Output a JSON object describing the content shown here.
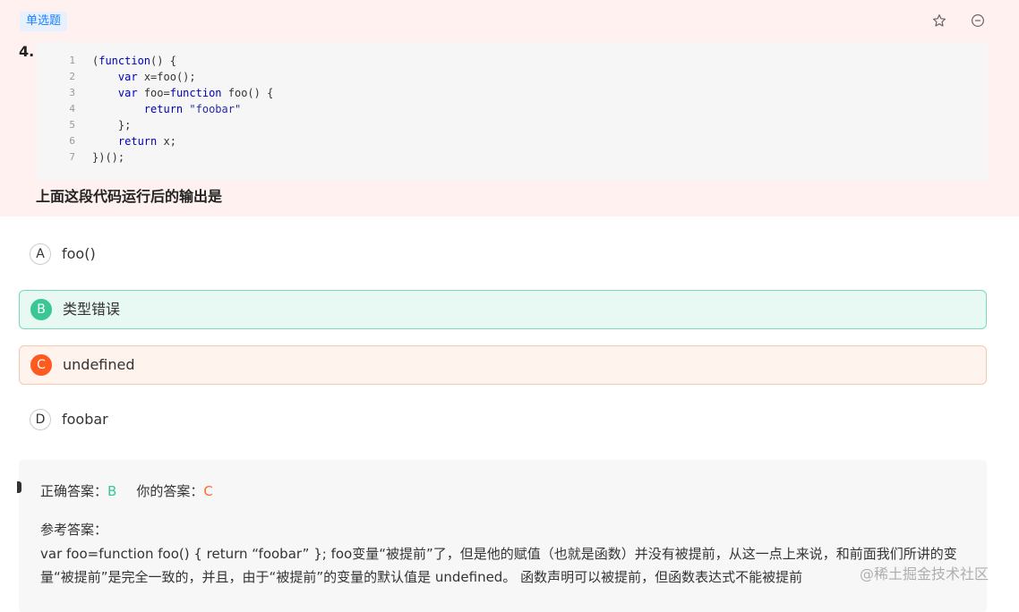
{
  "question": {
    "type_tag": "单选题",
    "number": "4.",
    "code_lines": [
      {
        "n": "1",
        "parts": [
          {
            "t": "(",
            "c": ""
          },
          {
            "t": "function",
            "c": "kw"
          },
          {
            "t": "() {",
            "c": ""
          }
        ]
      },
      {
        "n": "2",
        "parts": [
          {
            "t": "    ",
            "c": ""
          },
          {
            "t": "var",
            "c": "kw"
          },
          {
            "t": " x=foo();",
            "c": ""
          }
        ]
      },
      {
        "n": "3",
        "parts": [
          {
            "t": "    ",
            "c": ""
          },
          {
            "t": "var",
            "c": "kw"
          },
          {
            "t": " foo=",
            "c": ""
          },
          {
            "t": "function",
            "c": "kw"
          },
          {
            "t": " foo() {",
            "c": ""
          }
        ]
      },
      {
        "n": "4",
        "parts": [
          {
            "t": "        ",
            "c": ""
          },
          {
            "t": "return",
            "c": "kw"
          },
          {
            "t": " ",
            "c": ""
          },
          {
            "t": "\"foobar\"",
            "c": "str"
          }
        ]
      },
      {
        "n": "5",
        "parts": [
          {
            "t": "    };",
            "c": ""
          }
        ]
      },
      {
        "n": "6",
        "parts": [
          {
            "t": "    ",
            "c": ""
          },
          {
            "t": "return",
            "c": "kw"
          },
          {
            "t": " x;",
            "c": ""
          }
        ]
      },
      {
        "n": "7",
        "parts": [
          {
            "t": "})();",
            "c": ""
          }
        ]
      }
    ],
    "prompt": "上面这段代码运行后的输出是"
  },
  "options": [
    {
      "letter": "A",
      "text": "foo()",
      "state": "normal"
    },
    {
      "letter": "B",
      "text": "类型错误",
      "state": "correct"
    },
    {
      "letter": "C",
      "text": "undefined",
      "state": "wrong"
    },
    {
      "letter": "D",
      "text": "foobar",
      "state": "normal"
    }
  ],
  "analysis": {
    "correct_label": "正确答案：",
    "correct_value": "B",
    "your_label": "你的答案：",
    "your_value": "C",
    "ref_label": "参考答案：",
    "ref_text": "var foo=function foo() { return “foobar” }; foo变量“被提前”了，但是他的赋值（也就是函数）并没有被提前，从这一点上来说，和前面我们所讲的变量“被提前”是完全一致的，并且，由于“被提前”的变量的默认值是 undefined。 函数声明可以被提前，但函数表达式不能被提前"
  },
  "watermark": "@稀土掘金技术社区",
  "colors": {
    "correct": "#3bc794",
    "wrong": "#ff5a1f",
    "tag": "#1e80ff",
    "header_bg": "#fff1f0"
  }
}
